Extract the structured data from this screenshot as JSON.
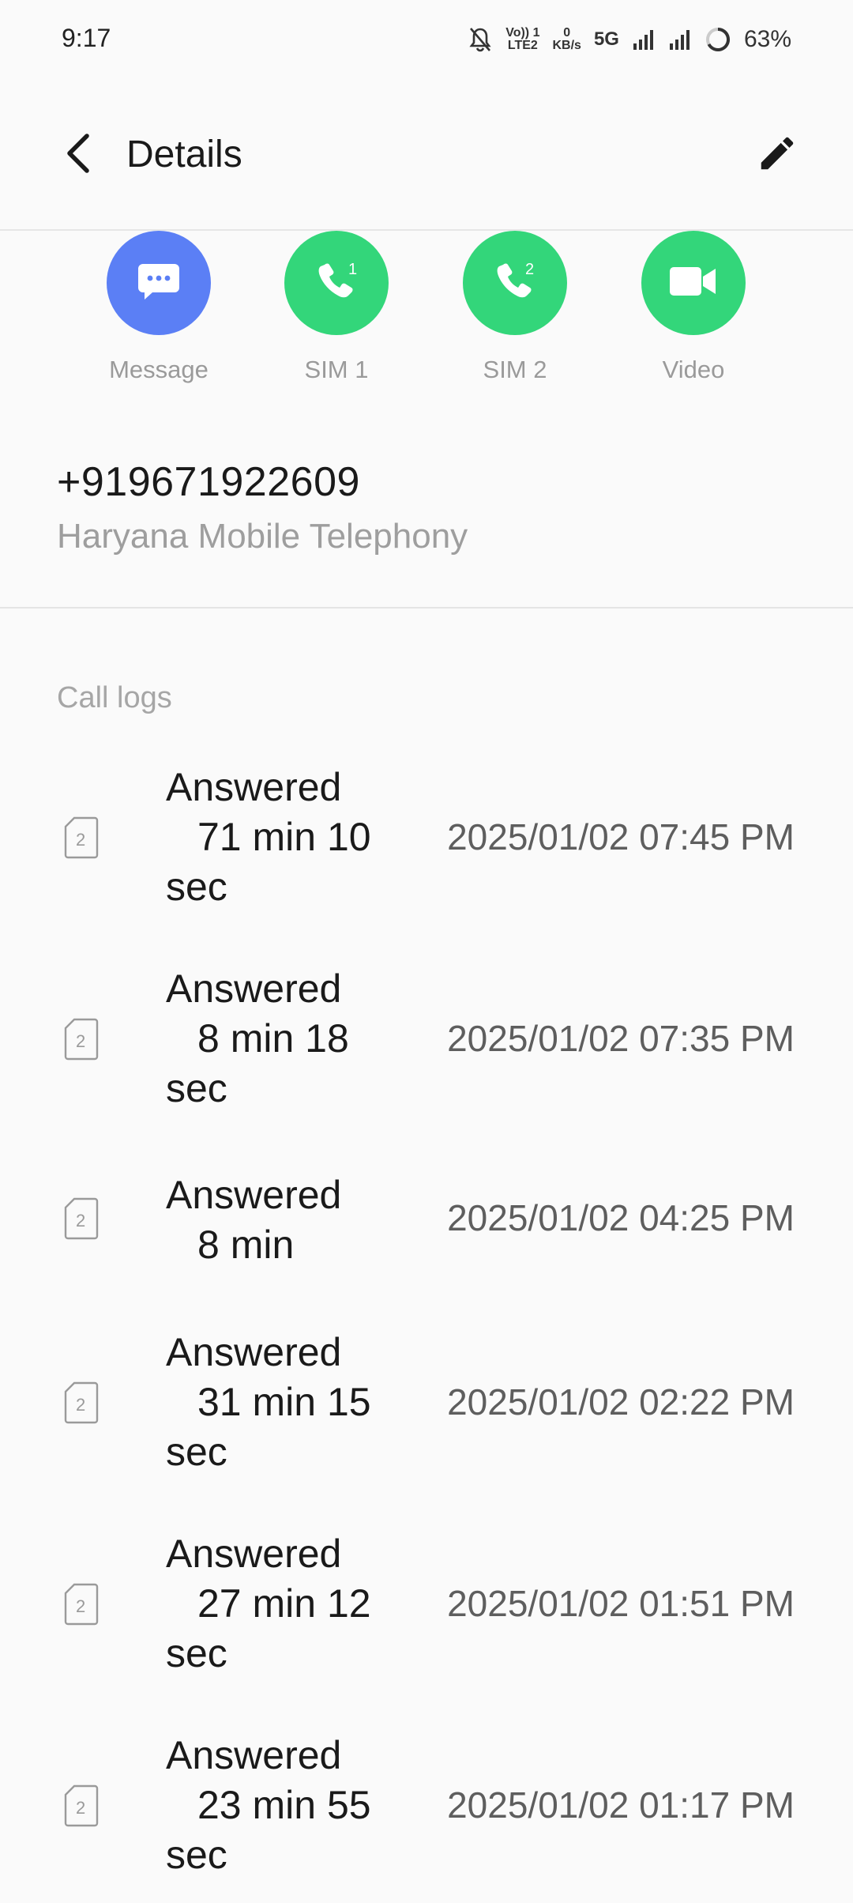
{
  "status_bar": {
    "time": "9:17",
    "volte": "Vo)) 1",
    "lte": "LTE2",
    "speed_top": "0",
    "speed_bottom": "KB/s",
    "network": "5G",
    "battery": "63%"
  },
  "header": {
    "title": "Details",
    "back_icon": "back-arrow-icon",
    "edit_icon": "pencil-icon"
  },
  "actions": [
    {
      "label": "Message",
      "icon": "message-icon",
      "color": "#5b7ff5"
    },
    {
      "label": "SIM 1",
      "icon": "phone-sim1-icon",
      "badge": "1",
      "color": "#33d67a"
    },
    {
      "label": "SIM 2",
      "icon": "phone-sim2-icon",
      "badge": "2",
      "color": "#33d67a"
    },
    {
      "label": "Video",
      "icon": "video-icon",
      "color": "#33d67a"
    }
  ],
  "contact": {
    "number": "+919671922609",
    "carrier": "Haryana Mobile Telephony"
  },
  "call_logs": {
    "title": "Call logs",
    "entries": [
      {
        "sim": "2",
        "status": "Answered",
        "duration": "71 min 10",
        "duration_tail": "sec",
        "datetime": "2025/01/02 07:45 PM"
      },
      {
        "sim": "2",
        "status": "Answered",
        "duration": "8 min 18",
        "duration_tail": "sec",
        "datetime": "2025/01/02 07:35 PM"
      },
      {
        "sim": "2",
        "status": "Answered",
        "duration": "8 min",
        "duration_tail": "",
        "datetime": "2025/01/02 04:25 PM"
      },
      {
        "sim": "2",
        "status": "Answered",
        "duration": "31 min 15",
        "duration_tail": "sec",
        "datetime": "2025/01/02 02:22 PM"
      },
      {
        "sim": "2",
        "status": "Answered",
        "duration": "27 min 12",
        "duration_tail": "sec",
        "datetime": "2025/01/02 01:51 PM"
      },
      {
        "sim": "2",
        "status": "Answered",
        "duration": "23 min 55",
        "duration_tail": "sec",
        "datetime": "2025/01/02 01:17 PM"
      }
    ]
  }
}
